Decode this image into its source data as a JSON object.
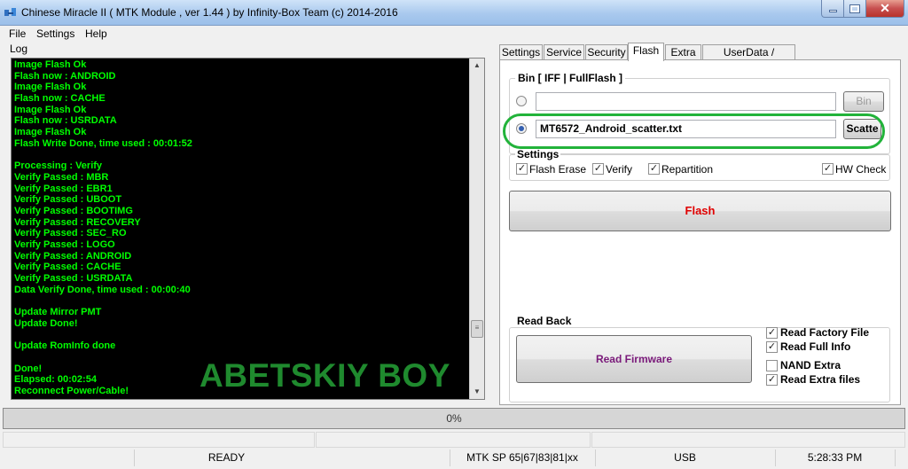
{
  "window": {
    "title": "Chinese Miracle II ( MTK Module , ver 1.44 ) by Infinity-Box Team (c) 2014-2016"
  },
  "menu": [
    "File",
    "Settings",
    "Help"
  ],
  "log": {
    "label": "Log",
    "lines": [
      "Image Flash Ok",
      "Flash now : ANDROID",
      "Image Flash Ok",
      "Flash now : CACHE",
      "Image Flash Ok",
      "Flash now : USRDATA",
      "Image Flash Ok",
      "Flash Write Done, time used : 00:01:52",
      "",
      "Processing : Verify",
      "Verify Passed : MBR",
      "Verify Passed : EBR1",
      "Verify Passed : UBOOT",
      "Verify Passed : BOOTIMG",
      "Verify Passed : RECOVERY",
      "Verify Passed : SEC_RO",
      "Verify Passed : LOGO",
      "Verify Passed : ANDROID",
      "Verify Passed : CACHE",
      "Verify Passed : USRDATA",
      "Data Verify Done, time used : 00:00:40",
      "",
      "Update Mirror PMT",
      "Update Done!",
      "",
      "Update RomInfo done",
      "",
      "Done!",
      "Elapsed: 00:02:54",
      "Reconnect Power/Cable!"
    ],
    "watermark": "ABETSKIY BOY"
  },
  "tabs": [
    {
      "label": "Settings",
      "active": false
    },
    {
      "label": "Service",
      "active": false
    },
    {
      "label": "Security",
      "active": false
    },
    {
      "label": "Flash",
      "active": true
    },
    {
      "label": "Extra",
      "active": false
    },
    {
      "label": "UserData / Forensic",
      "active": false
    }
  ],
  "flash": {
    "bin_group_title": "Bin  [ IFF | FullFlash ]",
    "bin_path_value": "",
    "bin_button": "Bin",
    "scatter_path_value": "MT6572_Android_scatter.txt",
    "scatter_button": "Scatte",
    "settings_title": "Settings",
    "options": {
      "flash_erase": "Flash Erase",
      "verify": "Verify",
      "repartition": "Repartition",
      "hw_check": "HW Check"
    },
    "flash_button": "Flash",
    "accent_color": "#e00000"
  },
  "readback": {
    "title": "Read Back",
    "read_button": "Read Firmware",
    "button_color": "#7a1a7a",
    "options": {
      "read_factory_file": "Read Factory File",
      "read_full_info": "Read Full Info",
      "nand_extra": "NAND Extra",
      "read_extra_files": "Read Extra files"
    },
    "checked": {
      "read_factory_file": true,
      "read_full_info": true,
      "nand_extra": false,
      "read_extra_files": true
    }
  },
  "progress": {
    "text": "0%",
    "value": 0
  },
  "status": {
    "state": "READY",
    "platform": "MTK SP 65|67|83|81|xx",
    "connection": "USB",
    "time": "5:28:33 PM"
  }
}
